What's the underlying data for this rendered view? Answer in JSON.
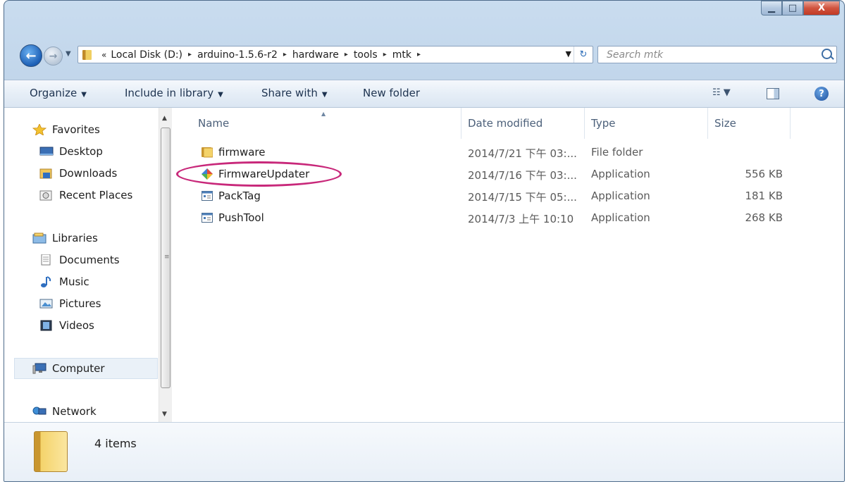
{
  "window": {
    "caption_buttons": {
      "minimize": "▁",
      "maximize": "□",
      "close": "X"
    }
  },
  "address_bar": {
    "overflow": "«",
    "crumbs": [
      "Local Disk (D:)",
      "arduino-1.5.6-r2",
      "hardware",
      "tools",
      "mtk"
    ],
    "separator": "▸",
    "refresh": "↻"
  },
  "search": {
    "placeholder": "Search mtk"
  },
  "toolbar": {
    "organize": "Organize",
    "include_in_library": "Include in library",
    "share_with": "Share with",
    "new_folder": "New folder",
    "caret": "▼",
    "help": "?"
  },
  "nav": {
    "favorites": "Favorites",
    "desktop": "Desktop",
    "downloads": "Downloads",
    "recent_places": "Recent Places",
    "libraries": "Libraries",
    "documents": "Documents",
    "music": "Music",
    "pictures": "Pictures",
    "videos": "Videos",
    "computer": "Computer",
    "network": "Network"
  },
  "columns": {
    "name": "Name",
    "date": "Date modified",
    "type": "Type",
    "size": "Size"
  },
  "files": [
    {
      "name": "firmware",
      "date": "2014/7/21 下午 03:...",
      "type": "File folder",
      "size": ""
    },
    {
      "name": "FirmwareUpdater",
      "date": "2014/7/16 下午 03:...",
      "type": "Application",
      "size": "556 KB"
    },
    {
      "name": "PackTag",
      "date": "2014/7/15 下午 05:...",
      "type": "Application",
      "size": "181 KB"
    },
    {
      "name": "PushTool",
      "date": "2014/7/3 上午 10:10",
      "type": "Application",
      "size": "268 KB"
    }
  ],
  "status": {
    "item_count": "4 items"
  },
  "colors": {
    "highlight_ring": "#c8287a",
    "window_frame": "#aac4df",
    "close_button": "#c13a24"
  }
}
